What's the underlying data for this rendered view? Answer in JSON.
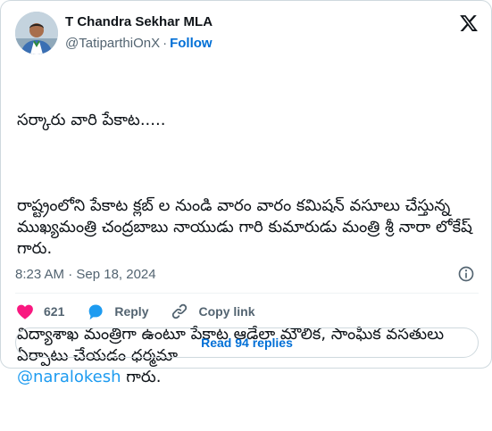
{
  "author": {
    "display_name": "T Chandra Sekhar MLA",
    "handle": "@TatiparthiOnX",
    "separator": "·",
    "follow_label": "Follow"
  },
  "tweet": {
    "paragraphs": [
      "సర్కారు వారి పేకాట.....",
      "రాష్ట్రంలోని పేకాట క్లబ్ ల నుండి వారం వారం కమిషన్ వసూలు చేస్తున్న ముఖ్యమంత్రి చంద్రబాబు నాయుడు గారి కుమారుడు మంత్రి శ్రీ నారా లోకేష్ గారు.",
      "విద్యాశాఖ మంత్రిగా ఉంటూ పేకాట ఆడేలా మౌలిక, సాంఘిక వసతులు ఏర్పాటు చేయడం ధర్మమా"
    ],
    "mention": "@naralokesh",
    "mention_suffix": " గారు."
  },
  "meta": {
    "timestamp": "8:23 AM · Sep 18, 2024"
  },
  "actions": {
    "likes_count": "621",
    "reply_label": "Reply",
    "copy_link_label": "Copy link"
  },
  "replies_button_label": "Read 94 replies",
  "colors": {
    "like_red": "#f91880",
    "reply_blue": "#1d9bf0",
    "link_blue": "#006fd6",
    "muted_gray": "#536471"
  }
}
